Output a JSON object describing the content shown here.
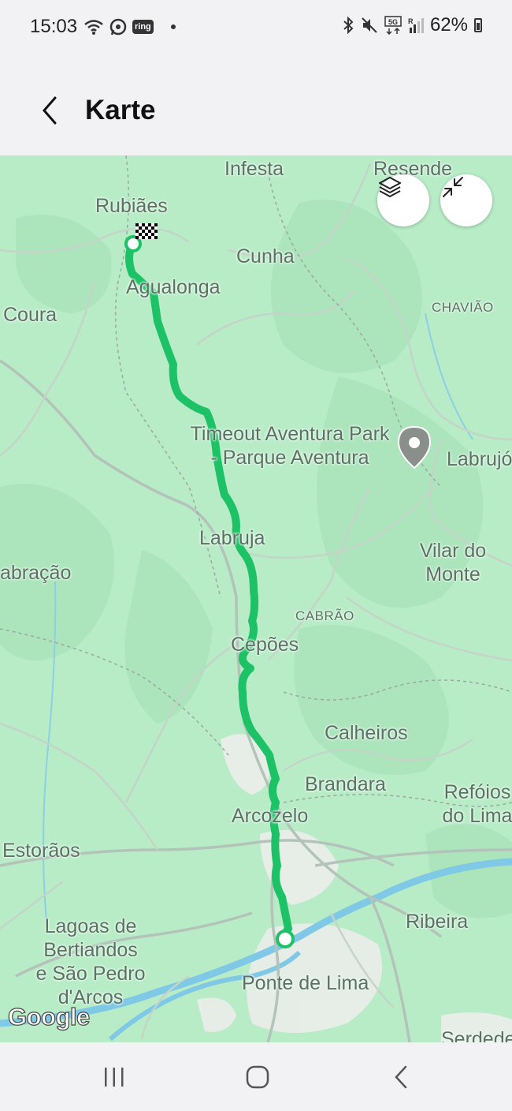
{
  "status_bar": {
    "time": "15:03",
    "ring_label": "ring",
    "battery": "62%",
    "icons": [
      "wifi-icon",
      "whatsapp-icon",
      "ring-icon",
      "bluetooth-icon",
      "mute-icon",
      "5g-icon",
      "signal-icon",
      "battery-icon"
    ]
  },
  "app_bar": {
    "title": "Karte"
  },
  "map": {
    "labels": {
      "infesta": "Infesta",
      "resende": "Resende",
      "rubiaes": "Rubiães",
      "cunha": "Cunha",
      "agualonga": "Agualonga",
      "coura": "Coura",
      "chaviao": "CHAVIÃO",
      "timeout_line1": "Timeout Aventura Park",
      "timeout_line2": "- Parque Aventura",
      "labrujo": "Labrujó",
      "labruja": "Labruja",
      "vilar_line1": "Vilar do",
      "vilar_line2": "Monte",
      "abracao": "abração",
      "cabrao": "CABRÃO",
      "cepoes": "Cepões",
      "calheiros": "Calheiros",
      "brandara": "Brandara",
      "refoios_line1": "Refóios",
      "refoios_line2": "do Lima",
      "arcozelo": "Arcozelo",
      "estoraos": "Estorãos",
      "ribeira": "Ribeira",
      "lagoas_line1": "Lagoas de",
      "lagoas_line2": "Bertiandos",
      "lagoas_line3": "e São Pedro",
      "lagoas_line4": "d'Arcos",
      "ponte_de_lima": "Ponte de Lima",
      "serdedelo": "Serdede",
      "google": "Google"
    },
    "route_color": "#1dc266",
    "map_color": "#b7ecc6",
    "controls": [
      "layers-icon",
      "collapse-icon"
    ]
  },
  "nav_bar": {
    "icons": [
      "recents-icon",
      "home-icon",
      "back-nav-icon"
    ]
  }
}
